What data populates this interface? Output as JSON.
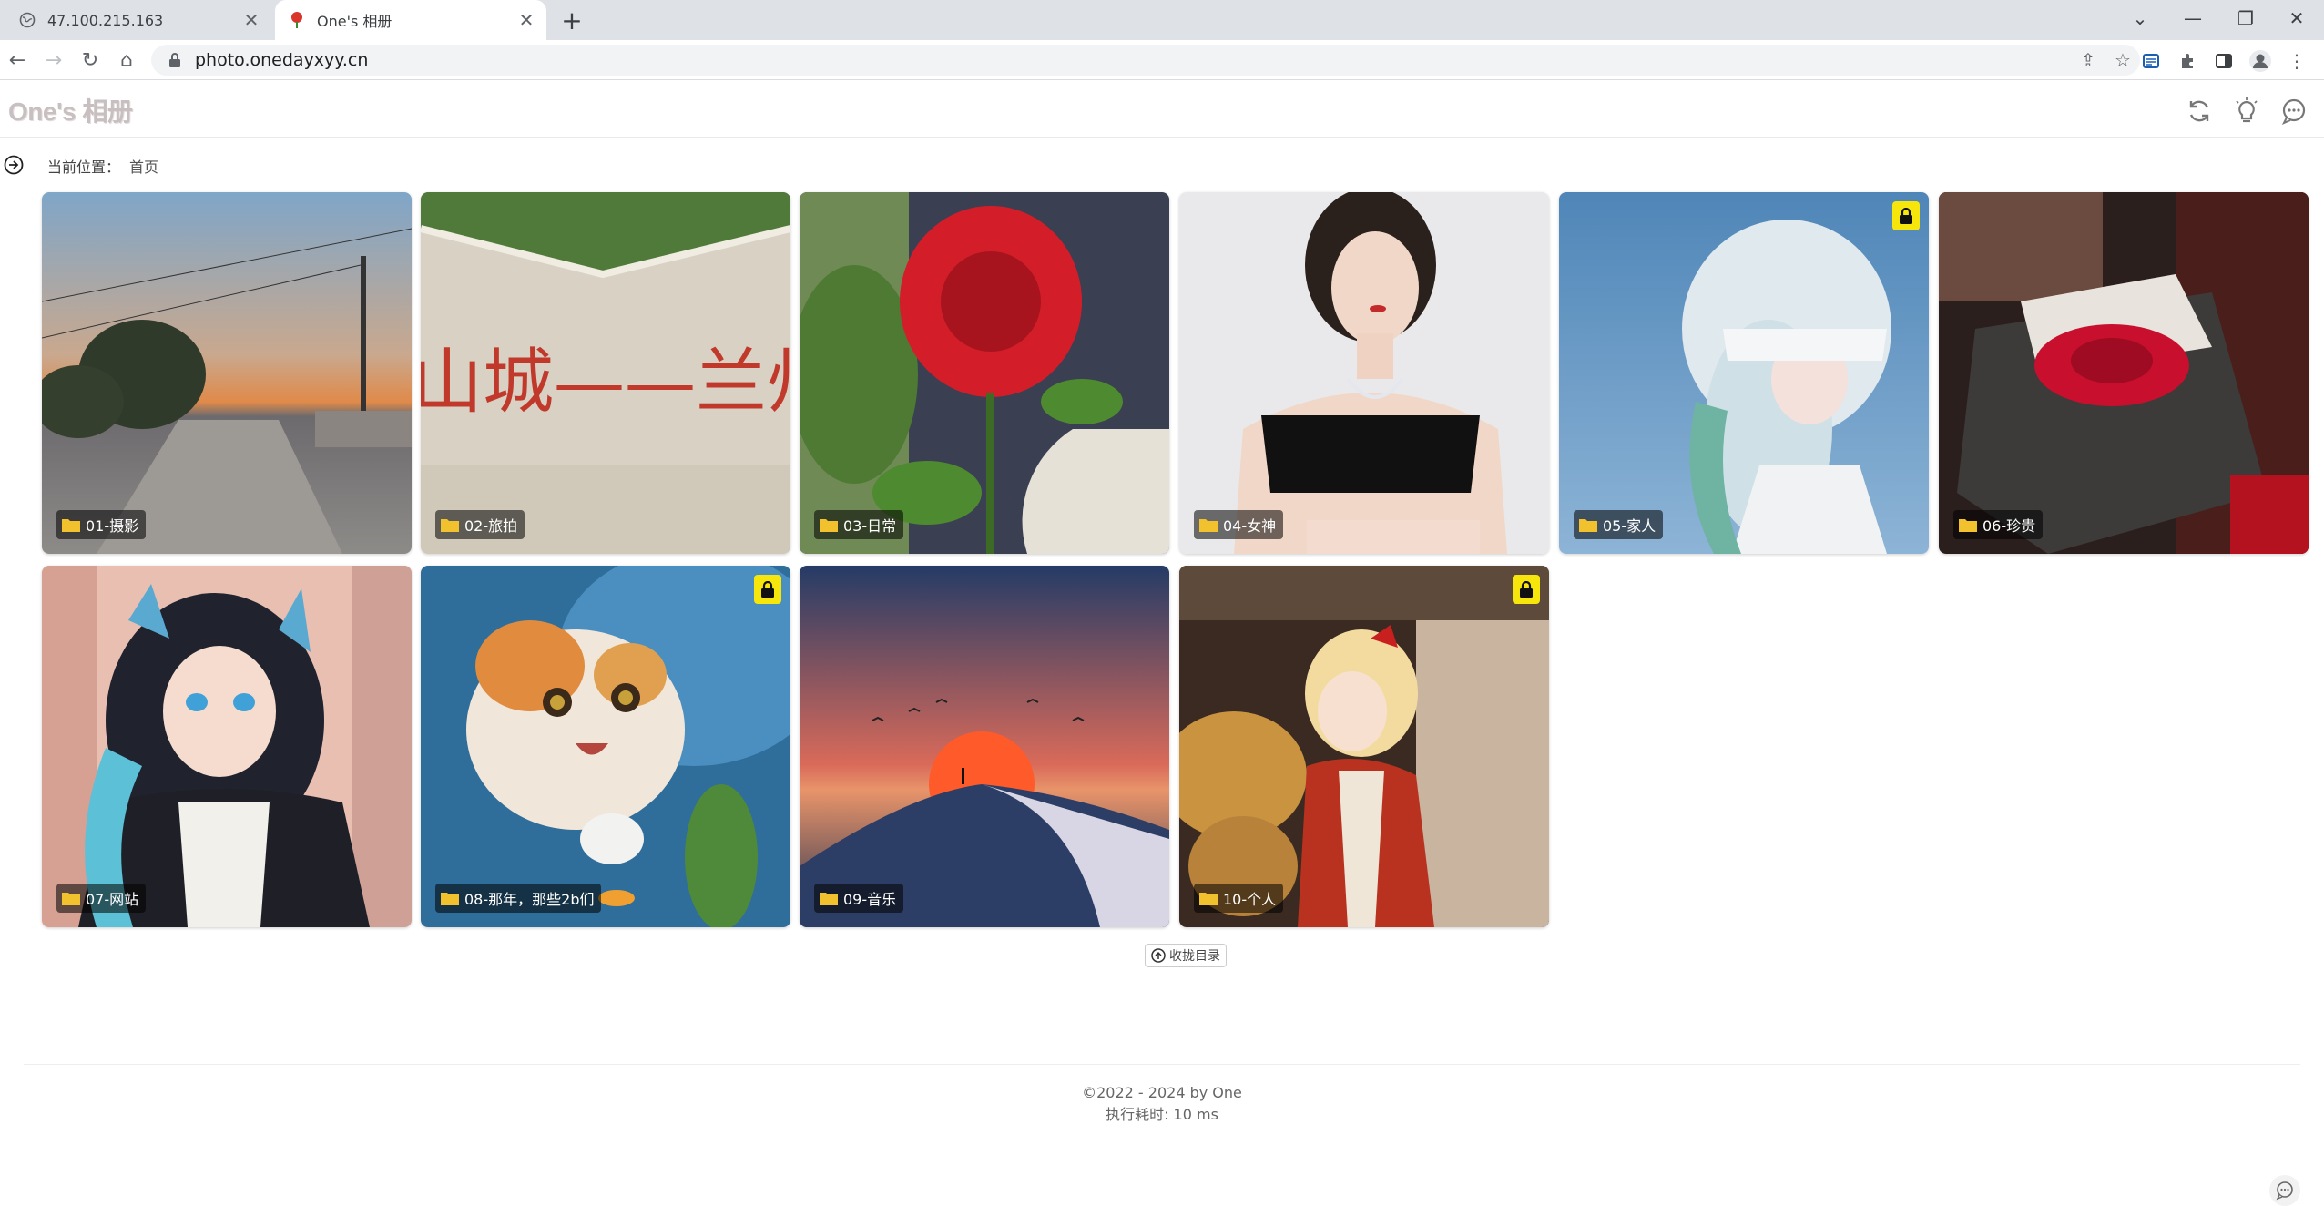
{
  "browser": {
    "tabs": [
      {
        "title": "47.100.215.163",
        "active": false
      },
      {
        "title": "One's 相册",
        "active": true
      }
    ],
    "address": "photo.onedayxyy.cn"
  },
  "site": {
    "title": "One's 相册",
    "breadcrumb_label": "当前位置：",
    "breadcrumb_home": "首页"
  },
  "albums": [
    {
      "name": "01-摄影",
      "locked": false
    },
    {
      "name": "02-旅拍",
      "locked": false
    },
    {
      "name": "03-日常",
      "locked": false
    },
    {
      "name": "04-女神",
      "locked": false
    },
    {
      "name": "05-家人",
      "locked": true
    },
    {
      "name": "06-珍贵",
      "locked": false
    },
    {
      "name": "07-网站",
      "locked": false
    },
    {
      "name": "08-那年，那些2b们",
      "locked": true
    },
    {
      "name": "09-音乐",
      "locked": false
    },
    {
      "name": "10-个人",
      "locked": true
    }
  ],
  "collapse_label": "收拢目录",
  "footer": {
    "copyright": "©2022 - 2024 by",
    "author": "One",
    "exec_time": "执行耗时: 10 ms"
  },
  "colors": {
    "lock_badge": "#f6e60b",
    "title_gray": "#c8c0c0"
  }
}
